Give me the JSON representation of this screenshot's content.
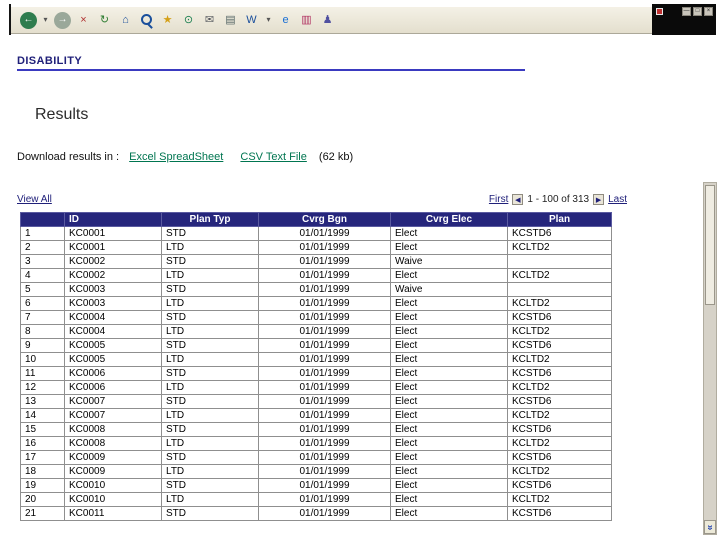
{
  "colors": {
    "accent_navy": "#20207a",
    "header_bg": "#26267c",
    "link_green": "#007550",
    "rule_blue": "#3a3ac0"
  },
  "window": {
    "buttons": [
      {
        "name": "minimize-button",
        "glyph": "—"
      },
      {
        "name": "maximize-button",
        "glyph": "□"
      },
      {
        "name": "close-button",
        "glyph": "×"
      }
    ]
  },
  "toolbar": {
    "icons": [
      {
        "name": "back-icon",
        "glyph": "←",
        "bg": "#2f7d4f"
      },
      {
        "name": "back-dropdown-icon",
        "glyph": "▾",
        "color": "#555555"
      },
      {
        "name": "forward-icon",
        "glyph": "→",
        "bg": "#9aa89a"
      },
      {
        "name": "stop-icon",
        "glyph": "×",
        "color": "#b03030"
      },
      {
        "name": "refresh-icon",
        "glyph": "↻",
        "color": "#2e7d32"
      },
      {
        "name": "home-icon",
        "glyph": "⌂",
        "color": "#1a4f9c"
      },
      {
        "name": "search-icon",
        "glyph": "",
        "color": "#1a4f9c"
      },
      {
        "name": "favorites-icon",
        "glyph": "★",
        "color": "#d4a017"
      },
      {
        "name": "history-icon",
        "glyph": "⊙",
        "color": "#1a7f4f"
      },
      {
        "name": "mail-icon",
        "glyph": "✉",
        "color": "#55585e"
      },
      {
        "name": "print-icon",
        "glyph": "▤",
        "color": "#566"
      },
      {
        "name": "word-icon",
        "glyph": "W",
        "color": "#1a4f9c"
      },
      {
        "name": "toolbar-dropdown-icon",
        "glyph": "▾",
        "color": "#555555"
      },
      {
        "name": "discuss-icon",
        "glyph": "e",
        "color": "#1a6fd4"
      },
      {
        "name": "charts-icon",
        "glyph": "▥",
        "color": "#b03060"
      },
      {
        "name": "people-icon",
        "glyph": "♟",
        "color": "#5050a0"
      }
    ]
  },
  "scrollbar": {
    "down_glyph": "»"
  },
  "page": {
    "section_title": "DISABILITY",
    "results_title": "Results",
    "download": {
      "prefix": "Download results in :",
      "excel_link": "Excel SpreadSheet",
      "csv_link": "CSV Text File",
      "size_note": "(62 kb)"
    },
    "pager": {
      "view_all": "View All",
      "first_label": "First",
      "first_icon": "◀",
      "range": "1 - 100 of 313",
      "next_icon": "▶",
      "last_label": "Last"
    }
  },
  "table": {
    "headers": [
      "",
      "ID",
      "Plan Typ",
      "Cvrg Bgn",
      "Cvrg Elec",
      "Plan"
    ],
    "rows": [
      [
        "1",
        "KC0001",
        "STD",
        "01/01/1999",
        "Elect",
        "KCSTD6"
      ],
      [
        "2",
        "KC0001",
        "LTD",
        "01/01/1999",
        "Elect",
        "KCLTD2"
      ],
      [
        "3",
        "KC0002",
        "STD",
        "01/01/1999",
        "Waive",
        ""
      ],
      [
        "4",
        "KC0002",
        "LTD",
        "01/01/1999",
        "Elect",
        "KCLTD2"
      ],
      [
        "5",
        "KC0003",
        "STD",
        "01/01/1999",
        "Waive",
        ""
      ],
      [
        "6",
        "KC0003",
        "LTD",
        "01/01/1999",
        "Elect",
        "KCLTD2"
      ],
      [
        "7",
        "KC0004",
        "STD",
        "01/01/1999",
        "Elect",
        "KCSTD6"
      ],
      [
        "8",
        "KC0004",
        "LTD",
        "01/01/1999",
        "Elect",
        "KCLTD2"
      ],
      [
        "9",
        "KC0005",
        "STD",
        "01/01/1999",
        "Elect",
        "KCSTD6"
      ],
      [
        "10",
        "KC0005",
        "LTD",
        "01/01/1999",
        "Elect",
        "KCLTD2"
      ],
      [
        "11",
        "KC0006",
        "STD",
        "01/01/1999",
        "Elect",
        "KCSTD6"
      ],
      [
        "12",
        "KC0006",
        "LTD",
        "01/01/1999",
        "Elect",
        "KCLTD2"
      ],
      [
        "13",
        "KC0007",
        "STD",
        "01/01/1999",
        "Elect",
        "KCSTD6"
      ],
      [
        "14",
        "KC0007",
        "LTD",
        "01/01/1999",
        "Elect",
        "KCLTD2"
      ],
      [
        "15",
        "KC0008",
        "STD",
        "01/01/1999",
        "Elect",
        "KCSTD6"
      ],
      [
        "16",
        "KC0008",
        "LTD",
        "01/01/1999",
        "Elect",
        "KCLTD2"
      ],
      [
        "17",
        "KC0009",
        "STD",
        "01/01/1999",
        "Elect",
        "KCSTD6"
      ],
      [
        "18",
        "KC0009",
        "LTD",
        "01/01/1999",
        "Elect",
        "KCLTD2"
      ],
      [
        "19",
        "KC0010",
        "STD",
        "01/01/1999",
        "Elect",
        "KCSTD6"
      ],
      [
        "20",
        "KC0010",
        "LTD",
        "01/01/1999",
        "Elect",
        "KCLTD2"
      ],
      [
        "21",
        "KC0011",
        "STD",
        "01/01/1999",
        "Elect",
        "KCSTD6"
      ]
    ]
  }
}
